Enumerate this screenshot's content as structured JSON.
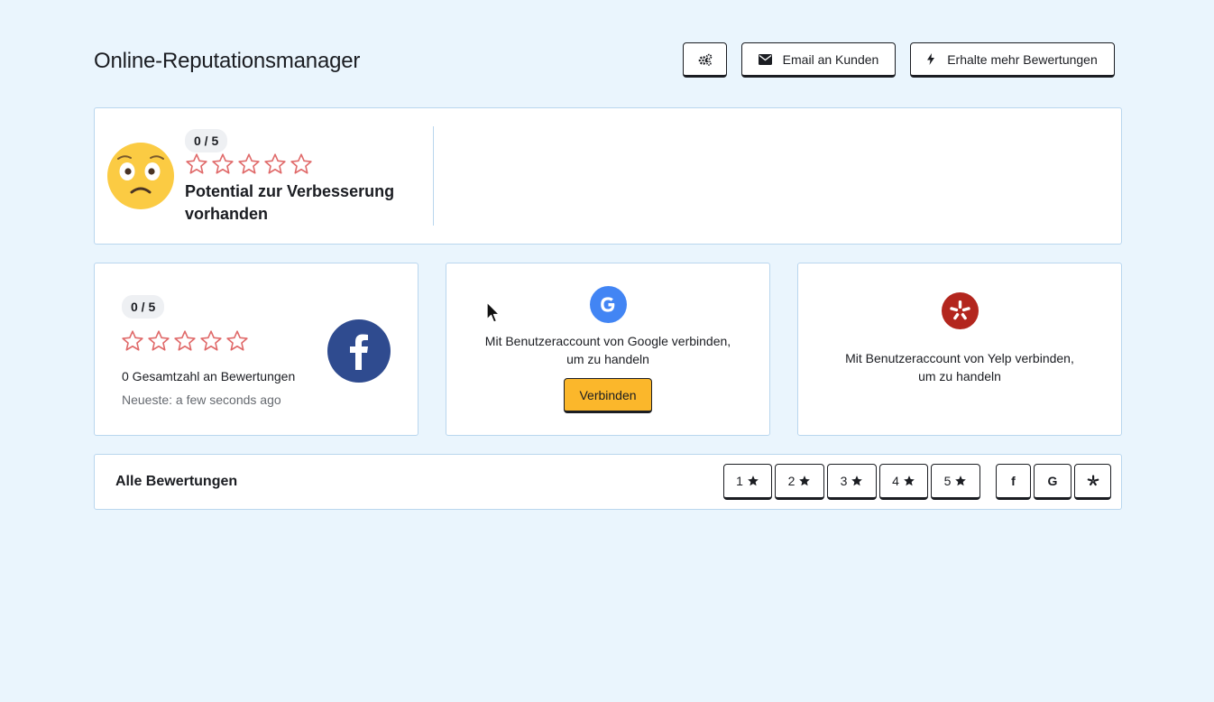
{
  "header": {
    "title": "Online-Reputationsmanager",
    "settings_icon": "gears-icon",
    "email_label": "Email an Kunden",
    "more_reviews_label": "Erhalte mehr Bewertungen"
  },
  "summary": {
    "rating": "0 / 5",
    "stars_filled": 0,
    "stars_total": 5,
    "message": "Potential zur Verbesserung vorhanden",
    "emoji": "worried-face-icon"
  },
  "facebook": {
    "rating": "0 / 5",
    "stars_filled": 0,
    "total_label": "0 Gesamtzahl an Bewertungen",
    "newest_label": "Neueste: a few seconds ago",
    "brand_color": "#2f4b8f"
  },
  "google": {
    "connect_text_line1": "Mit Benutzeraccount von Google verbinden,",
    "connect_text_line2": "um zu handeln",
    "connect_button": "Verbinden",
    "brand_color": "#4285f4"
  },
  "yelp": {
    "connect_text_line1": "Mit Benutzeraccount von Yelp verbinden,",
    "connect_text_line2": "um zu handeln",
    "brand_color": "#b3261e"
  },
  "reviews": {
    "title": "Alle Bewertungen",
    "star_filters": [
      "1",
      "2",
      "3",
      "4",
      "5"
    ],
    "source_filters": [
      "f",
      "G",
      "yelp-icon"
    ]
  },
  "colors": {
    "background": "#eaf5fd",
    "star_outline": "#e06a6a",
    "accent_button": "#fbb72b"
  }
}
